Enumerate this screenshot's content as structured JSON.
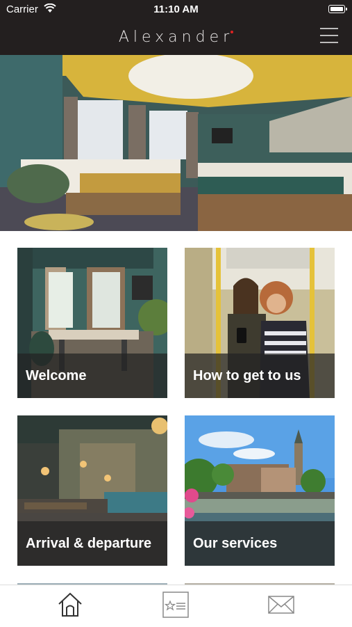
{
  "status_bar": {
    "carrier": "Carrier",
    "time": "11:10 AM"
  },
  "header": {
    "brand": "Alexander"
  },
  "tiles": [
    {
      "label": "Welcome"
    },
    {
      "label": "How to get to us"
    },
    {
      "label": "Arrival & departure"
    },
    {
      "label": "Our services"
    }
  ],
  "tab_bar": {
    "tabs": [
      {
        "icon": "home-icon"
      },
      {
        "icon": "info-card-icon"
      },
      {
        "icon": "mail-icon"
      }
    ]
  }
}
